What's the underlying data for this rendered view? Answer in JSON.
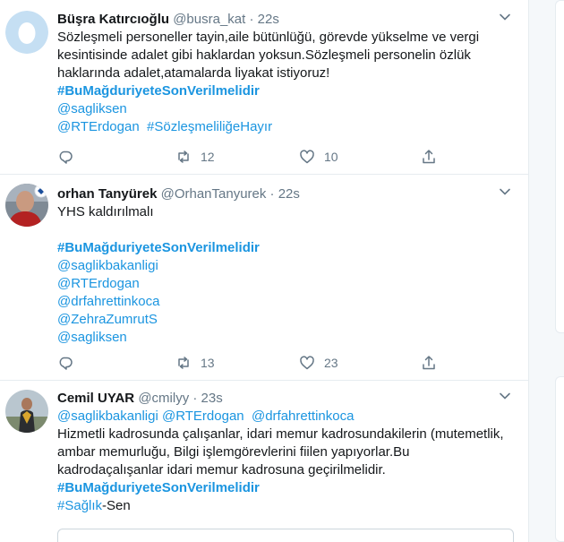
{
  "tweets": [
    {
      "fullname": "Büşra Katırcıoğlu",
      "handle": "@busra_kat",
      "time": "22s",
      "lines": [
        "Sözleşmeli  personeller tayin,aile bütünlüğü, görevde yükselme ve vergi",
        "kesintisinde adalet gibi haklardan yoksun.Sözleşmeli personelin özlük",
        "haklarında adalet,atamalarda liyakat istiyoruz!"
      ],
      "hashtag": "#BuMağduriyeteSonVerilmelidir",
      "mention1": "@sagliksen",
      "mention2": "@RTErdogan",
      "hashtag2": "#SözleşmeliliğeHayır",
      "retweets": "12",
      "likes": "10"
    },
    {
      "fullname": "orhan Tanyürek",
      "handle": "@OrhanTanyurek",
      "time": "22s",
      "text": "YHS kaldırılmalı",
      "hashtag": "#BuMağduriyeteSonVerilmelidir",
      "mentions": [
        "@saglikbakanligi",
        "@RTErdogan",
        "@drfahrettinkoca",
        "@ZehraZumrutS",
        "@sagliksen"
      ],
      "retweets": "13",
      "likes": "23"
    },
    {
      "fullname": "Cemil UYAR",
      "handle": "@cmilyy",
      "time": "23s",
      "mentions": [
        "@saglikbakanligi",
        "@RTErdogan",
        "@drfahrettinkoca"
      ],
      "lines": [
        "Hizmetli kadrosunda çalışanlar, idari memur kadrosundakilerin (mutemetlik,",
        "ambar memurluğu, Bilgi işlemgörevlerini fiilen yapıyorlar.Bu",
        "kadrodaçalışanlar idari memur kadrosuna geçirilmelidir."
      ],
      "hashtag": "#BuMağduriyeteSonVerilmelidir",
      "hashtag2": "#Sağlık",
      "suffix": "-Sen"
    }
  ],
  "separator_dot": "·",
  "colors": {
    "link": "#1b95e0",
    "muted": "#657786",
    "border": "#e6ecf0"
  }
}
